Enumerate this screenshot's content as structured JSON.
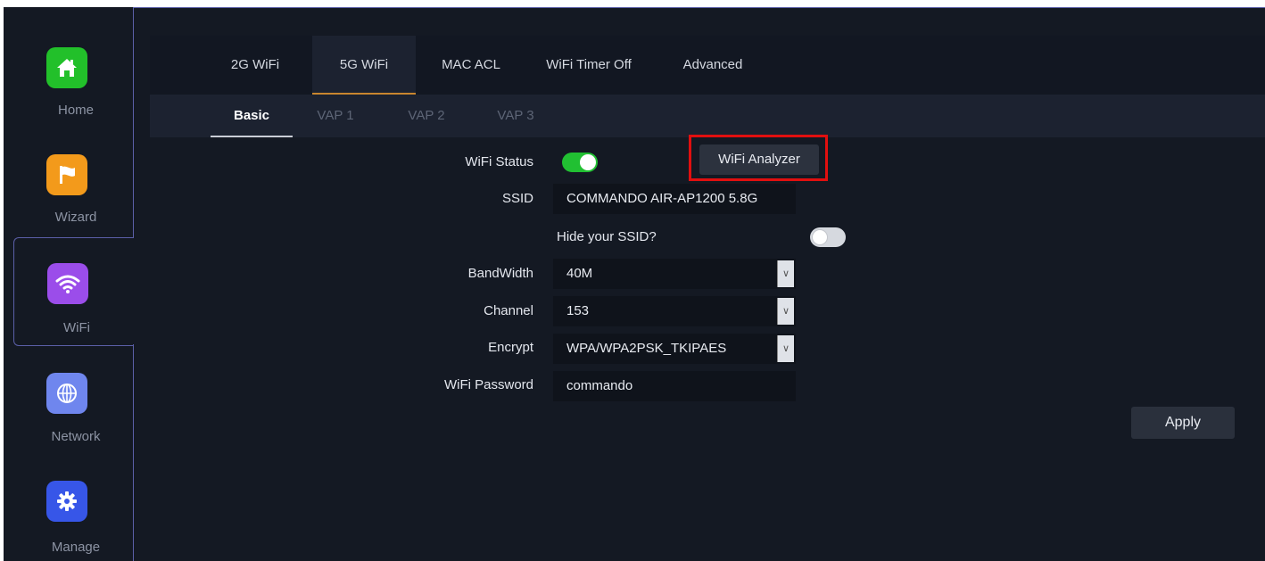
{
  "sidebar": {
    "items": [
      {
        "label": "Home",
        "icon": "home-icon",
        "color": "#22c02a"
      },
      {
        "label": "Wizard",
        "icon": "flag-icon",
        "color": "#f39a1b"
      },
      {
        "label": "WiFi",
        "icon": "wifi-icon",
        "color": "#9b4dea"
      },
      {
        "label": "Network",
        "icon": "globe-icon",
        "color": "#6f86ee"
      },
      {
        "label": "Manage",
        "icon": "gear-icon",
        "color": "#3756e8"
      }
    ],
    "active": "WiFi"
  },
  "tabs": [
    "2G WiFi",
    "5G WiFi",
    "MAC ACL",
    "WiFi Timer Off",
    "Advanced"
  ],
  "active_tab": "5G WiFi",
  "subtabs": [
    "Basic",
    "VAP 1",
    "VAP 2",
    "VAP 3"
  ],
  "active_subtab": "Basic",
  "form": {
    "wifi_status_label": "WiFi Status",
    "wifi_status_on": true,
    "analyzer_button": "WiFi Analyzer",
    "ssid_label": "SSID",
    "ssid_value": "COMMANDO AIR-AP1200 5.8G",
    "hide_ssid_label": "Hide your SSID?",
    "hide_ssid_on": false,
    "bandwidth_label": "BandWidth",
    "bandwidth_value": "40M",
    "channel_label": "Channel",
    "channel_value": "153",
    "encrypt_label": "Encrypt",
    "encrypt_value": "WPA/WPA2PSK_TKIPAES",
    "password_label": "WiFi Password",
    "password_value": "commando"
  },
  "apply_button": "Apply",
  "colors": {
    "toggle_on": "#21c032",
    "toggle_off": "#d6d9df",
    "highlight": "#e10f0f",
    "active_tab_underline": "#c9862e"
  }
}
